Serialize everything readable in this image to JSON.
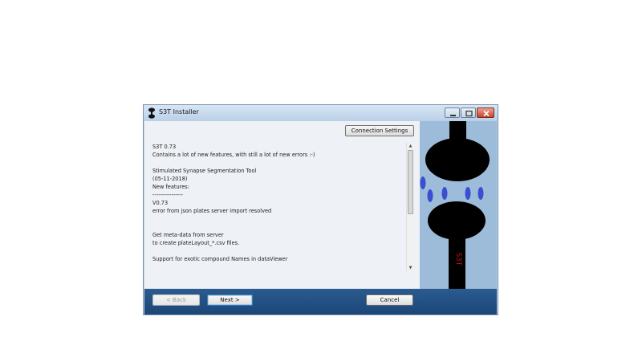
{
  "window": {
    "title": "S3T Installer"
  },
  "toolbar": {
    "connection_settings_label": "Connection Settings"
  },
  "release_notes": {
    "lines": [
      "S3T 0.73",
      "Contains a lot of new features, with still a lot of new errors :-)",
      "",
      "Stimulated Synapse Segmentation Tool",
      "(05-11-2018)",
      "New features:",
      "----------------",
      "V0.73",
      "error from json plates server import resolved",
      "",
      "",
      "Get meta-data from server",
      "to create plateLayout_*.csv files.",
      "",
      "Support for exotic compound Names in dataViewer"
    ]
  },
  "sidebar": {
    "side_label": "S3T",
    "colors": {
      "background": "#9dbcd9",
      "shape": "#000000",
      "vesicle": "#3a4fd0",
      "label": "#c81010"
    }
  },
  "footer": {
    "back_label": "< Back",
    "next_label": "Next >",
    "cancel_label": "Cancel"
  },
  "colors": {
    "footer": "#1f4c7f",
    "window_frame": "#bcd3ea",
    "close_button": "#c9442a"
  }
}
